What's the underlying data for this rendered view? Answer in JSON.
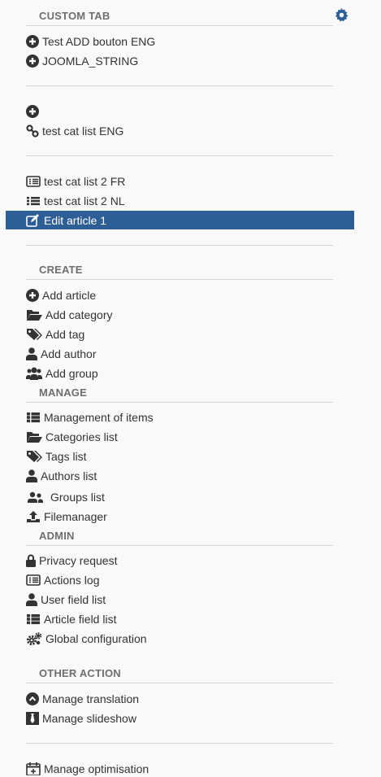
{
  "custom_tab": {
    "title": "CUSTOM TAB",
    "items": [
      {
        "label": "Test ADD bouton ENG",
        "icon": "plus-circle-icon"
      },
      {
        "label": "JOOMLA_STRING",
        "icon": "plus-circle-icon"
      },
      {
        "label": "",
        "icon": "plus-circle-icon"
      },
      {
        "label": "test cat list ENG",
        "icon": "link-icon"
      },
      {
        "label": "test cat list 2 FR",
        "icon": "list-alt-icon"
      },
      {
        "label": "test cat list 2 NL",
        "icon": "list-icon"
      },
      {
        "label": "Edit article 1",
        "icon": "edit-icon"
      }
    ]
  },
  "create": {
    "title": "CREATE",
    "items": [
      {
        "label": "Add article",
        "icon": "plus-circle-icon"
      },
      {
        "label": "Add category",
        "icon": "folder-open-icon"
      },
      {
        "label": "Add tag",
        "icon": "tags-icon"
      },
      {
        "label": "Add author",
        "icon": "user-icon"
      },
      {
        "label": "Add group",
        "icon": "users-icon"
      }
    ]
  },
  "manage": {
    "title": "MANAGE",
    "items": [
      {
        "label": "Management of items",
        "icon": "th-list-icon"
      },
      {
        "label": "Categories list",
        "icon": "folder-open-icon"
      },
      {
        "label": "Tags list",
        "icon": "tags-icon"
      },
      {
        "label": "Authors list",
        "icon": "user-icon"
      },
      {
        "label": "Groups list",
        "icon": "user-friends-icon"
      },
      {
        "label": "Filemanager",
        "icon": "upload-icon"
      }
    ]
  },
  "admin": {
    "title": "ADMIN",
    "items": [
      {
        "label": "Privacy request",
        "icon": "lock-icon"
      },
      {
        "label": "Actions log",
        "icon": "list-alt-icon"
      },
      {
        "label": "User field list",
        "icon": "user-icon"
      },
      {
        "label": "Article field list",
        "icon": "th-list-icon"
      },
      {
        "label": "Global configuration",
        "icon": "cogs-icon"
      }
    ]
  },
  "other_action": {
    "title": "OTHER ACTION",
    "items": [
      {
        "label": "Manage translation",
        "icon": "chevron-up-circle-icon"
      },
      {
        "label": "Manage slideshow",
        "icon": "tie-icon"
      },
      {
        "label": "Manage optimisation",
        "icon": "calendar-plus-icon"
      }
    ]
  },
  "colors": {
    "active_bg": "#2d5e95",
    "gear": "#2d5e95",
    "text": "#333333",
    "header": "#6e6e6e"
  }
}
